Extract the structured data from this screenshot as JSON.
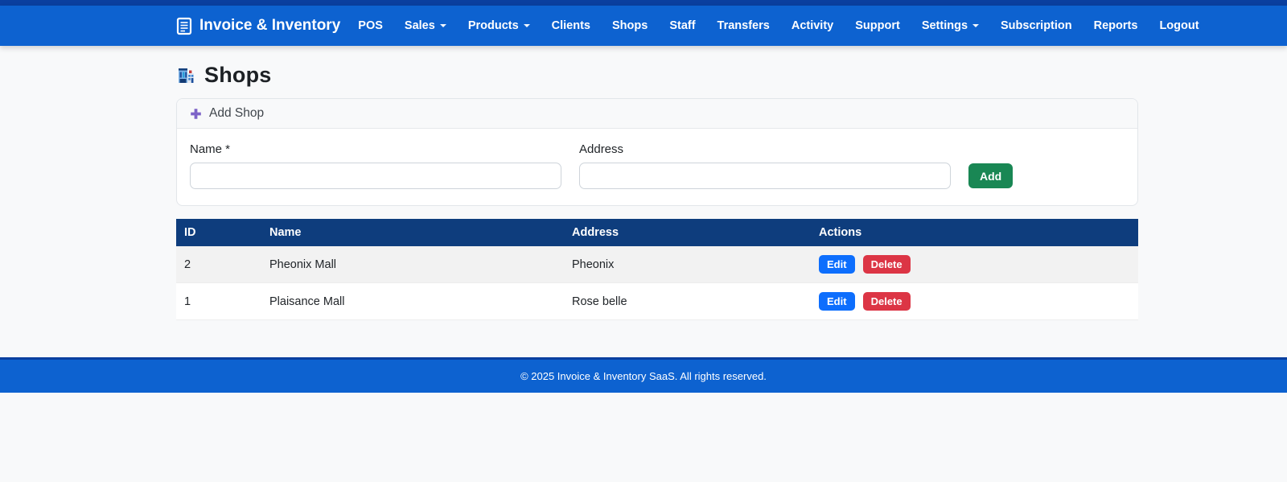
{
  "navbar": {
    "brand": "Invoice & Inventory",
    "items": [
      {
        "label": "POS",
        "dropdown": false
      },
      {
        "label": "Sales",
        "dropdown": true
      },
      {
        "label": "Products",
        "dropdown": true
      },
      {
        "label": "Clients",
        "dropdown": false
      },
      {
        "label": "Shops",
        "dropdown": false
      },
      {
        "label": "Staff",
        "dropdown": false
      },
      {
        "label": "Transfers",
        "dropdown": false
      },
      {
        "label": "Activity",
        "dropdown": false
      },
      {
        "label": "Support",
        "dropdown": false
      },
      {
        "label": "Settings",
        "dropdown": true
      },
      {
        "label": "Subscription",
        "dropdown": false
      },
      {
        "label": "Reports",
        "dropdown": false
      },
      {
        "label": "Logout",
        "dropdown": false
      }
    ]
  },
  "page": {
    "title": "Shops",
    "title_icon": "department-store-icon"
  },
  "add_shop": {
    "header": "Add Shop",
    "header_icon": "plus-icon",
    "name_label": "Name *",
    "name_value": "",
    "address_label": "Address",
    "address_value": "",
    "submit_label": "Add"
  },
  "table": {
    "headers": [
      "ID",
      "Name",
      "Address",
      "Actions"
    ],
    "rows": [
      {
        "id": "2",
        "name": "Pheonix Mall",
        "address": "Pheonix",
        "actions": [
          "Edit",
          "Delete"
        ]
      },
      {
        "id": "1",
        "name": "Plaisance Mall",
        "address": "Rose belle",
        "actions": [
          "Edit",
          "Delete"
        ]
      }
    ]
  },
  "footer": {
    "text": "© 2025 Invoice & Inventory SaaS. All rights reserved."
  },
  "colors": {
    "navbar_blue": "#0d62d0",
    "navbar_accent_navy": "#0a3f9f",
    "table_header_navy": "#0e3d7d",
    "add_button_green": "#198754",
    "edit_button_blue": "#0d6efd",
    "delete_button_red": "#dc3545",
    "plus_icon_purple": "#7d63c8",
    "page_background": "#f8f9fa"
  }
}
